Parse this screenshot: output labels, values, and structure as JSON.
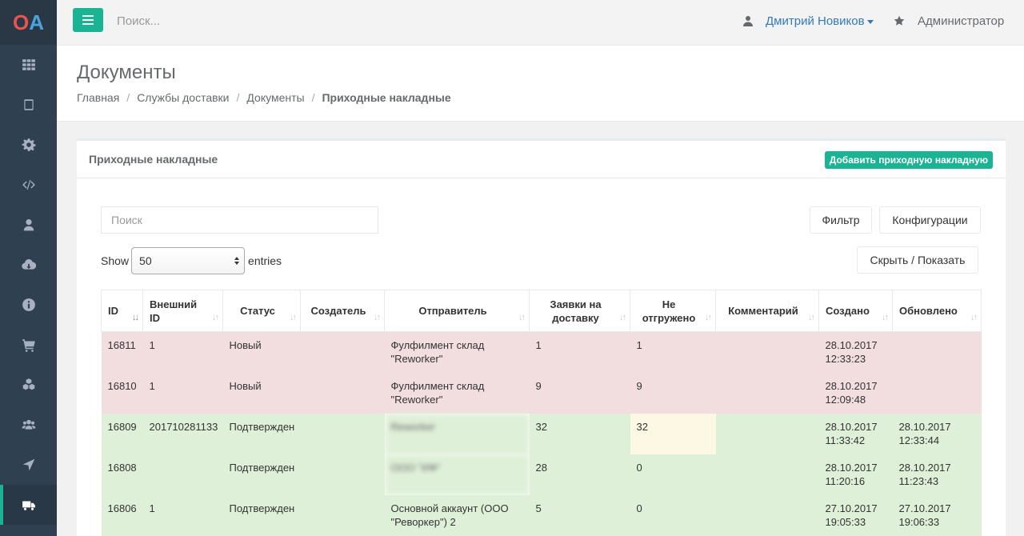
{
  "logo": {
    "part1": "O",
    "part2": "A"
  },
  "sidebar": {
    "items": [
      {
        "icon": "grid-icon"
      },
      {
        "icon": "tablet-icon"
      },
      {
        "icon": "gear-icon"
      },
      {
        "icon": "code-icon"
      },
      {
        "icon": "user-icon"
      },
      {
        "icon": "cloud-download-icon"
      },
      {
        "icon": "info-icon"
      },
      {
        "icon": "cart-icon"
      },
      {
        "icon": "cubes-icon"
      },
      {
        "icon": "users-icon"
      },
      {
        "icon": "location-arrow-icon"
      },
      {
        "icon": "truck-icon",
        "active": true
      }
    ]
  },
  "topbar": {
    "search_placeholder": "Поиск...",
    "user_name": "Дмитрий Новиков",
    "role": "Администратор"
  },
  "heading": {
    "title": "Документы",
    "breadcrumb": [
      "Главная",
      "Службы доставки",
      "Документы",
      "Приходные накладные"
    ]
  },
  "panel": {
    "title": "Приходные накладные",
    "add_button": "Добавить приходную накладную",
    "search_placeholder": "Поиск",
    "filter_button": "Фильтр",
    "config_button": "Конфигурации",
    "toggle_button": "Скрыть / Показать",
    "show_label": "Show",
    "entries_value": "50",
    "entries_label": "entries"
  },
  "table": {
    "headers": [
      "ID",
      "Внешний ID",
      "Статус",
      "Создатель",
      "Отправитель",
      "Заявки на доставку",
      "Не отгружено",
      "Комментарий",
      "Создано",
      "Обновлено"
    ],
    "rows": [
      {
        "id": "16811",
        "ext_id": "1",
        "status": "Новый",
        "creator": "",
        "sender": "Фулфилмент склад \"Reworker\"",
        "requests": "1",
        "not_shipped": "1",
        "comment": "",
        "created": "28.10.2017 12:33:23",
        "updated": ""
      },
      {
        "id": "16810",
        "ext_id": "1",
        "status": "Новый",
        "creator": "",
        "sender": "Фулфилмент склад \"Reworker\"",
        "requests": "9",
        "not_shipped": "9",
        "comment": "",
        "created": "28.10.2017 12:09:48",
        "updated": ""
      },
      {
        "id": "16809",
        "ext_id": "201710281133",
        "status": "Подтвержден",
        "creator": "",
        "sender": "Reworker",
        "requests": "32",
        "not_shipped": "32",
        "comment": "",
        "created": "28.10.2017 11:33:42",
        "updated": "28.10.2017 12:33:44"
      },
      {
        "id": "16808",
        "ext_id": "",
        "status": "Подтвержден",
        "creator": "",
        "sender": "ООО \"ИФ\"",
        "requests": "28",
        "not_shipped": "0",
        "comment": "",
        "created": "28.10.2017 11:20:16",
        "updated": "28.10.2017 11:23:43"
      },
      {
        "id": "16806",
        "ext_id": "1",
        "status": "Подтвержден",
        "creator": "",
        "sender": "Основной аккаунт (ООО \"Реворкер\") 2",
        "requests": "5",
        "not_shipped": "0",
        "comment": "",
        "created": "27.10.2017 19:05:33",
        "updated": "27.10.2017 19:06:33"
      }
    ]
  }
}
